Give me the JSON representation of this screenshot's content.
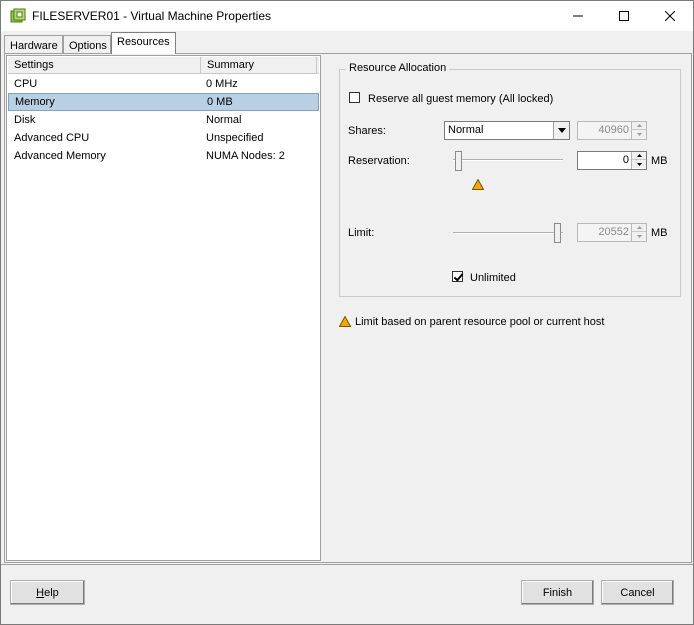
{
  "window": {
    "title": "FILESERVER01 - Virtual Machine Properties",
    "icon": "vm-properties-icon"
  },
  "tabs": [
    {
      "label": "Hardware",
      "active": false
    },
    {
      "label": "Options",
      "active": false
    },
    {
      "label": "Resources",
      "active": true
    }
  ],
  "settings_list": {
    "columns": [
      "Settings",
      "Summary"
    ],
    "rows": [
      {
        "setting": "CPU",
        "summary": "0 MHz",
        "selected": false
      },
      {
        "setting": "Memory",
        "summary": "0 MB",
        "selected": true
      },
      {
        "setting": "Disk",
        "summary": "Normal",
        "selected": false
      },
      {
        "setting": "Advanced CPU",
        "summary": "Unspecified",
        "selected": false
      },
      {
        "setting": "Advanced Memory",
        "summary": "NUMA Nodes: 2",
        "selected": false
      }
    ]
  },
  "resource_allocation": {
    "group_title": "Resource Allocation",
    "reserve_all": {
      "label": "Reserve all guest memory (All locked)",
      "checked": false
    },
    "shares": {
      "label": "Shares:",
      "selected": "Normal",
      "value": "40960",
      "enabled": false
    },
    "reservation": {
      "label": "Reservation:",
      "value": "0",
      "unit": "MB",
      "slider_fraction": 0.0,
      "warning": true
    },
    "limit": {
      "label": "Limit:",
      "value": "20552",
      "unit": "MB",
      "slider_fraction": 1.0,
      "enabled": false
    },
    "unlimited": {
      "label": "Unlimited",
      "checked": true
    }
  },
  "note": {
    "text": "Limit based on parent resource pool or current host",
    "icon": "warning-icon",
    "color": "#f5a800"
  },
  "buttons": {
    "help": "Help",
    "finish": "Finish",
    "cancel": "Cancel"
  }
}
